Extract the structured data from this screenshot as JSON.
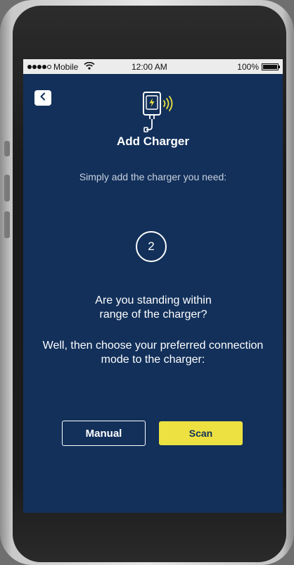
{
  "status_bar": {
    "carrier": "Mobile",
    "time": "12:00 AM",
    "battery": "100%"
  },
  "header": {
    "back_icon": "chevron-left-icon",
    "title": "Add Charger",
    "charger_icon": "charger-wireless-icon"
  },
  "main": {
    "subtitle": "Simply add the charger you need:",
    "step_number": "2",
    "question_line1": "Are you standing within",
    "question_line2": "range of the charger?",
    "instruction_line1": "Well, then choose your preferred connection",
    "instruction_line2": "mode to the charger:"
  },
  "actions": {
    "manual_label": "Manual",
    "scan_label": "Scan"
  },
  "colors": {
    "screen_background": "#12305a",
    "accent_yellow": "#ece140",
    "text_white": "#ffffff"
  }
}
